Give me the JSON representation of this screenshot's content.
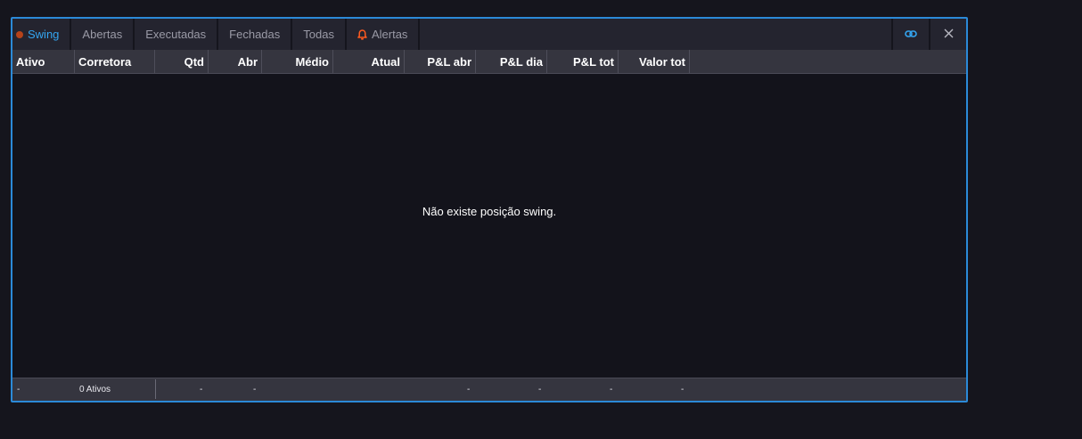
{
  "colors": {
    "accent": "#34a5f0",
    "panel_border": "#2b8ad8",
    "swing_dot": "#b5431a",
    "alert_bell": "#ff5a1f"
  },
  "tabs": [
    {
      "label": "Swing",
      "active": true,
      "icon": "dot-icon"
    },
    {
      "label": "Abertas"
    },
    {
      "label": "Executadas"
    },
    {
      "label": "Fechadas"
    },
    {
      "label": "Todas"
    },
    {
      "label": "Alertas",
      "icon": "bell-icon"
    }
  ],
  "toolbar": {
    "link_icon": "link-icon",
    "close_icon": "close-icon"
  },
  "columns": [
    {
      "label": "Ativo"
    },
    {
      "label": "Corretora"
    },
    {
      "label": "Qtd"
    },
    {
      "label": "Abr"
    },
    {
      "label": "Médio"
    },
    {
      "label": "Atual"
    },
    {
      "label": "P&L abr"
    },
    {
      "label": "P&L dia"
    },
    {
      "label": "P&L tot"
    },
    {
      "label": "Valor tot"
    }
  ],
  "empty_message": "Não existe posição swing.",
  "footer": {
    "ativo": "-",
    "count": "0 Ativos",
    "qtd": "-",
    "abr": "-",
    "pl_abr": "-",
    "pl_dia": "-",
    "pl_tot": "-",
    "valor_tot": "-"
  }
}
